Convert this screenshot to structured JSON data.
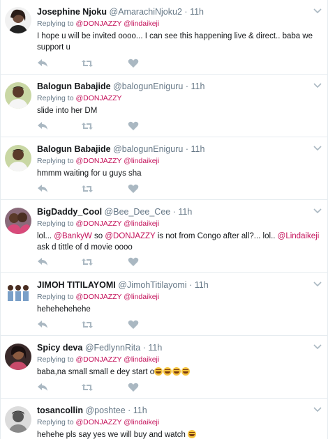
{
  "tweets": [
    {
      "name": "Josephine Njoku",
      "handle": "@AmarachiNjoku2",
      "time": "11h",
      "reply_prefix": "Replying to",
      "reply_to": [
        "@DONJAZZY",
        "@lindaikeji"
      ],
      "text": "I hope u will be invited oooo... I can see this happening live & direct.. baba we support u",
      "avatar": "woman-avatar-icon"
    },
    {
      "name": "Balogun Babajide",
      "handle": "@balogunEniguru",
      "time": "11h",
      "reply_prefix": "Replying to",
      "reply_to": [
        "@DONJAZZY"
      ],
      "text": "slide into her DM",
      "avatar": "man-avatar-icon"
    },
    {
      "name": "Balogun Babajide",
      "handle": "@balogunEniguru",
      "time": "11h",
      "reply_prefix": "Replying to",
      "reply_to": [
        "@DONJAZZY",
        "@lindaikeji"
      ],
      "text": "hmmm waiting for u guys sha",
      "avatar": "man-avatar-icon"
    },
    {
      "name": "BigDaddy_Cool",
      "handle": "@Bee_Dee_Cee",
      "time": "11h",
      "reply_prefix": "Replying to",
      "reply_to": [
        "@DONJAZZY",
        "@lindaikeji"
      ],
      "text_parts": [
        "lol... ",
        "@BankyW",
        " so ",
        "@DONJAZZY",
        " is not from Congo after all?... lol.. ",
        "@Lindaikeji",
        " ask d tittle of d movie oooo"
      ],
      "avatar": "couple-avatar-icon"
    },
    {
      "name": "JIMOH TITILAYOMI",
      "handle": "@JimohTitilayomi",
      "time": "11h",
      "reply_prefix": "Replying to",
      "reply_to": [
        "@DONJAZZY",
        "@lindaikeji"
      ],
      "text": "hehehehehehe",
      "avatar": "group-avatar-icon"
    },
    {
      "name": "Spicy deva",
      "handle": "@FedlynnRita",
      "time": "11h",
      "reply_prefix": "Replying to",
      "reply_to": [
        "@DONJAZZY",
        "@lindaikeji"
      ],
      "text": "baba,na small small e dey start o",
      "emoji_count": 4,
      "emoji": "laughing-tears-emoji",
      "avatar": "woman-avatar-icon"
    },
    {
      "name": "tosancollin",
      "handle": "@poshtee",
      "time": "11h",
      "reply_prefix": "Replying to",
      "reply_to": [
        "@DONJAZZY",
        "@lindaikeji"
      ],
      "text": "hehehe pls say yes we will buy and watch",
      "emoji_count": 1,
      "emoji": "laughing-tears-emoji",
      "avatar": "bw-avatar-icon"
    }
  ],
  "dot": "·",
  "icons": {
    "reply": "reply-arrow-icon",
    "retweet": "retweet-icon",
    "like": "heart-icon",
    "more": "chevron-down-icon"
  },
  "colors": {
    "mention": "#c4115a",
    "meta": "#657786",
    "icon": "#aab8c2",
    "divider": "#e6ecf0"
  }
}
